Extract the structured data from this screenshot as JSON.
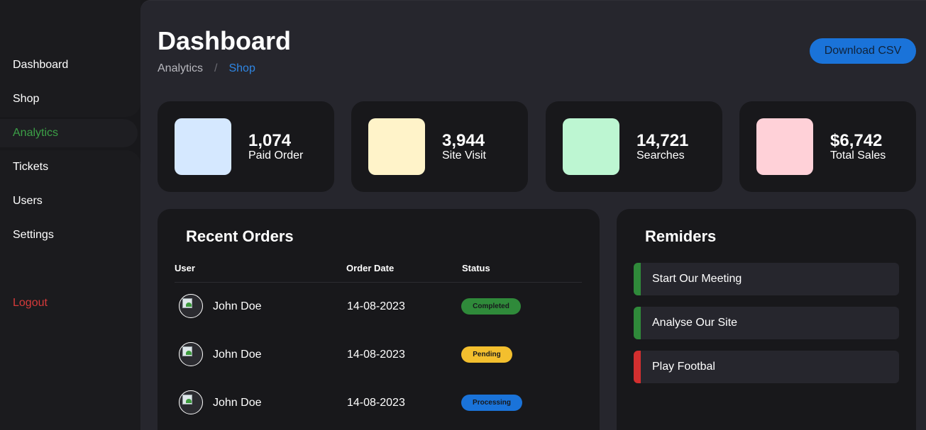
{
  "sidebar": {
    "items": [
      {
        "label": "Dashboard"
      },
      {
        "label": "Shop"
      },
      {
        "label": "Analytics"
      },
      {
        "label": "Tickets"
      },
      {
        "label": "Users"
      },
      {
        "label": "Settings"
      }
    ],
    "logout_label": "Logout",
    "active_color": "#3ca047",
    "logout_color": "#d63a3a"
  },
  "header": {
    "title": "Dashboard",
    "breadcrumb": [
      "Analytics",
      "/",
      "Shop"
    ],
    "download_label": "Download CSV"
  },
  "stats": [
    {
      "value": "1,074",
      "label": "Paid Order",
      "color": "#d5e8ff"
    },
    {
      "value": "3,944",
      "label": "Site Visit",
      "color": "#fff3c9"
    },
    {
      "value": "14,721",
      "label": "Searches",
      "color": "#bdf6d2"
    },
    {
      "value": "$6,742",
      "label": "Total Sales",
      "color": "#ffd1d8"
    }
  ],
  "orders": {
    "title": "Recent Orders",
    "columns": [
      "User",
      "Order Date",
      "Status"
    ],
    "rows": [
      {
        "user": "John Doe",
        "date": "14-08-2023",
        "status": "Completed"
      },
      {
        "user": "John Doe",
        "date": "14-08-2023",
        "status": "Pending"
      },
      {
        "user": "John Doe",
        "date": "14-08-2023",
        "status": "Processing"
      }
    ]
  },
  "reminders": {
    "title": "Remiders",
    "items": [
      {
        "text": "Start Our Meeting",
        "color": "#2f8a3a"
      },
      {
        "text": "Analyse Our Site",
        "color": "#2f8a3a"
      },
      {
        "text": "Play Footbal",
        "color": "#d32f2f"
      }
    ]
  }
}
